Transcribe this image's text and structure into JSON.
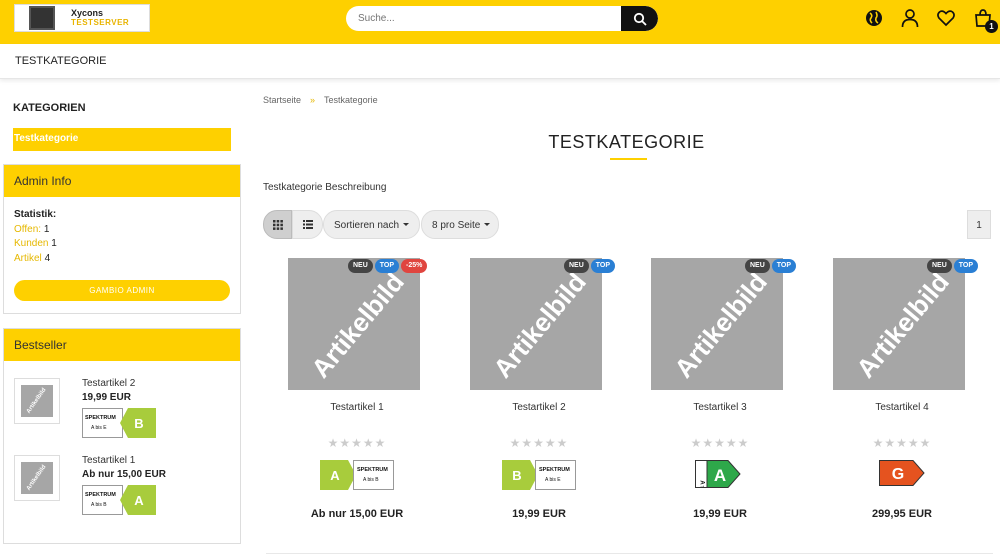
{
  "header": {
    "logo_line1": "Xycons",
    "logo_line2": "TESTSERVER",
    "search_placeholder": "Suche...",
    "icons": [
      "globe-icon",
      "user-icon",
      "heart-icon",
      "cart-icon"
    ],
    "cart_count": "1"
  },
  "nav": {
    "item": "TESTKATEGORIE"
  },
  "sidebar": {
    "categories_title": "KATEGORIEN",
    "category_item": "Testkategorie",
    "admin": {
      "title": "Admin Info",
      "stat_label": "Statistik:",
      "rows": [
        {
          "link": "Offen:",
          "value": "1"
        },
        {
          "link": "Kunden",
          "value": "1"
        },
        {
          "link": "Artikel",
          "value": "4"
        }
      ],
      "button": "GAMBIO ADMIN"
    },
    "bestseller": {
      "title": "Bestseller",
      "items": [
        {
          "name": "Testartikel 2",
          "price": "19,99 EUR",
          "thumb": "Artikelbild",
          "label_type": "spectrum",
          "label_class": "B",
          "label_title": "SPEKTRUM",
          "label_range": "A bis E",
          "label_color": "#a8cc3c"
        },
        {
          "name": "Testartikel 1",
          "price": "Ab nur 15,00 EUR",
          "thumb": "Artikelbild",
          "label_type": "spectrum",
          "label_class": "A",
          "label_title": "SPEKTRUM",
          "label_range": "A bis B",
          "label_color": "#a8cc3c"
        }
      ]
    }
  },
  "content": {
    "breadcrumb": {
      "home": "Startseite",
      "separator": "»",
      "current": "Testkategorie"
    },
    "title": "TESTKATEGORIE",
    "description": "Testkategorie Beschreibung",
    "sort_label": "Sortieren nach",
    "per_page_label": "8 pro Seite",
    "page": "1",
    "products": [
      {
        "image_text": "Artikelbild",
        "name": "Testartikel 1",
        "badges": [
          "NEU",
          "TOP",
          "-25%"
        ],
        "rating": 0,
        "stars": "★★★★★",
        "price": "Ab nur 15,00 EUR",
        "label_type": "spectrum-left",
        "label_class": "A",
        "label_title": "SPEKTRUM",
        "label_range": "A bis B",
        "label_color": "#a8cc3c"
      },
      {
        "image_text": "Artikelbild",
        "name": "Testartikel 2",
        "badges": [
          "NEU",
          "TOP"
        ],
        "rating": 0,
        "stars": "★★★★★",
        "price": "19,99 EUR",
        "label_type": "spectrum-left",
        "label_class": "B",
        "label_title": "SPEKTRUM",
        "label_range": "A bis E",
        "label_color": "#a8cc3c"
      },
      {
        "image_text": "Artikelbild",
        "name": "Testartikel 3",
        "badges": [
          "NEU",
          "TOP"
        ],
        "rating": 0,
        "stars": "★★★★★",
        "price": "19,99 EUR",
        "label_type": "arrow",
        "label_class": "A",
        "label_scale": "A↑E",
        "label_color": "#2ea84a"
      },
      {
        "image_text": "Artikelbild",
        "name": "Testartikel 4",
        "badges": [
          "NEU",
          "TOP"
        ],
        "rating": 0,
        "stars": "★★★★★",
        "price": "299,95 EUR",
        "label_type": "plain-arrow",
        "label_class": "G",
        "label_color": "#e5531f"
      }
    ]
  }
}
